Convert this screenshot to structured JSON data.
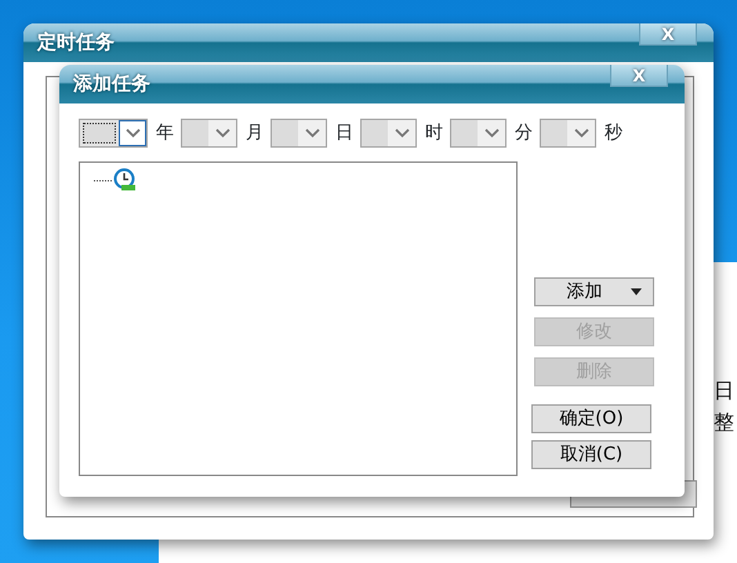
{
  "background_page": {
    "fragments": [
      "日",
      "整"
    ]
  },
  "outer_window": {
    "title": "定时任务",
    "close": "X"
  },
  "dialog": {
    "title": "添加任务",
    "close": "X",
    "date_fields": [
      {
        "unit": "年",
        "focused": true
      },
      {
        "unit": "月",
        "focused": false
      },
      {
        "unit": "日",
        "focused": false
      },
      {
        "unit": "时",
        "focused": false
      },
      {
        "unit": "分",
        "focused": false
      },
      {
        "unit": "秒",
        "focused": false
      }
    ],
    "tree": [
      {
        "kind": "clock-node"
      }
    ],
    "edit_buttons": [
      {
        "label": "添加",
        "dropdown": true,
        "disabled": false
      },
      {
        "label": "修改",
        "dropdown": false,
        "disabled": true
      },
      {
        "label": "删除",
        "dropdown": false,
        "disabled": true
      }
    ],
    "confirm_buttons": [
      {
        "label": "确定(O)",
        "disabled": false
      },
      {
        "label": "取消(C)",
        "disabled": false
      }
    ]
  }
}
